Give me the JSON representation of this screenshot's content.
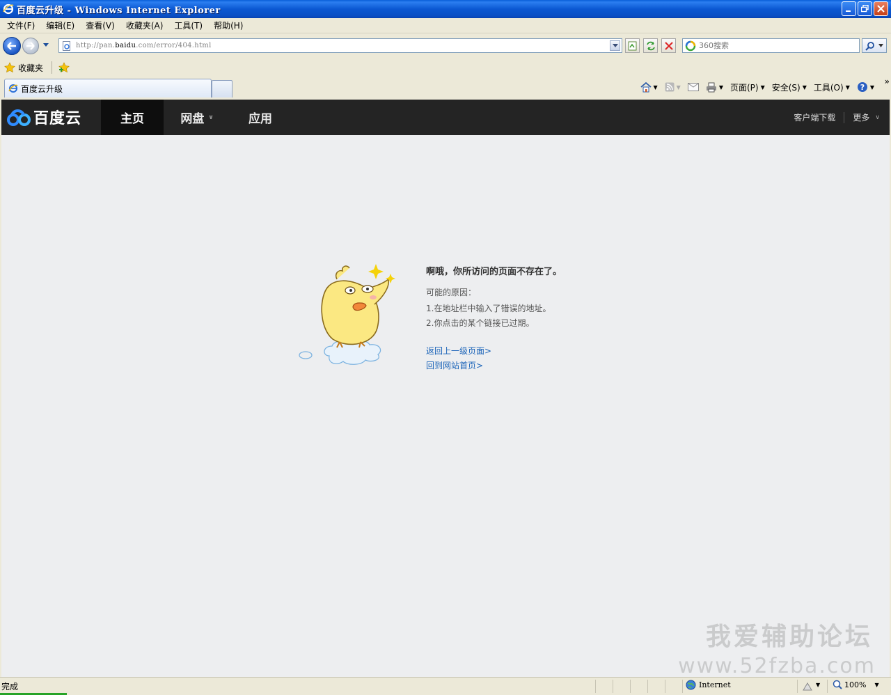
{
  "window": {
    "title": "百度云升级 - Windows Internet Explorer"
  },
  "menubar": {
    "items": [
      "文件(F)",
      "编辑(E)",
      "查看(V)",
      "收藏夹(A)",
      "工具(T)",
      "帮助(H)"
    ]
  },
  "addressbar": {
    "url_prefix": "http://pan.",
    "url_host": "baidu",
    "url_suffix": ".com/error/404.html"
  },
  "search": {
    "placeholder": "360搜索"
  },
  "favorites": {
    "label": "收藏夹"
  },
  "tabs": [
    {
      "label": "百度云升级"
    }
  ],
  "commandbar": {
    "page": "页面(P)",
    "safety": "安全(S)",
    "tools": "工具(O)",
    "more": "»"
  },
  "site": {
    "logo_text": "百度云",
    "nav": [
      "主页",
      "网盘",
      "应用"
    ],
    "right": [
      "客户端下载",
      "更多"
    ]
  },
  "error": {
    "title": "啊哦，你所访问的页面不存在了。",
    "reasons_label": "可能的原因：",
    "reasons": [
      "1.在地址栏中输入了错误的地址。",
      "2.你点击的某个链接已过期。"
    ],
    "links": [
      "返回上一级页面>",
      "回到网站首页>"
    ]
  },
  "watermark": {
    "line1": "我爱辅助论坛",
    "line2": "www.52fzba.com"
  },
  "statusbar": {
    "status": "完成",
    "zone": "Internet",
    "zoom": "100%"
  }
}
